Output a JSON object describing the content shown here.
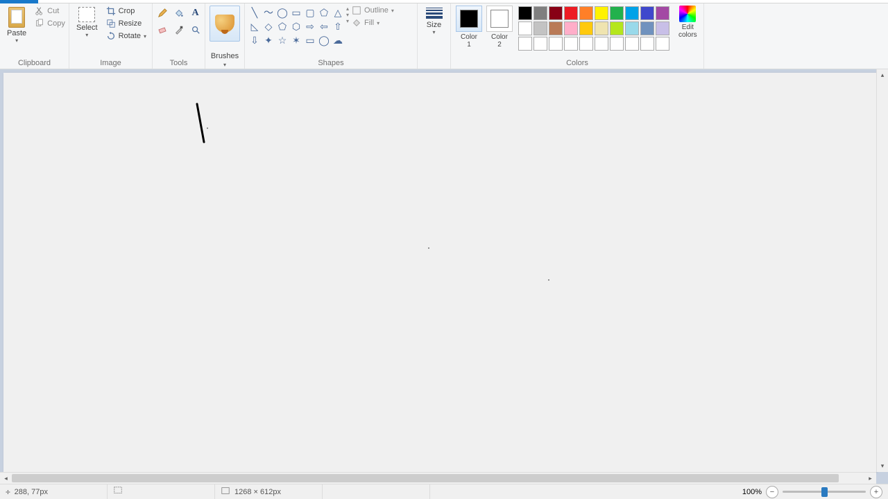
{
  "ribbon": {
    "groups": {
      "clipboard": {
        "label": "Clipboard",
        "paste": "Paste",
        "cut": "Cut",
        "copy": "Copy"
      },
      "image": {
        "label": "Image",
        "select": "Select",
        "crop": "Crop",
        "resize": "Resize",
        "rotate": "Rotate"
      },
      "tools": {
        "label": "Tools"
      },
      "brushes": {
        "label": "Brushes"
      },
      "shapes": {
        "label": "Shapes",
        "outline": "Outline",
        "fill": "Fill"
      },
      "size": {
        "label": "Size"
      },
      "colors": {
        "label": "Colors",
        "color1": "Color\n1",
        "color2": "Color\n2",
        "edit": "Edit\ncolors"
      }
    }
  },
  "palette_row1": [
    "#000000",
    "#7f7f7f",
    "#880015",
    "#ed1c24",
    "#ff7f27",
    "#fff200",
    "#22b14c",
    "#00a2e8",
    "#3f48cc",
    "#a349a4"
  ],
  "palette_row2": [
    "#ffffff",
    "#c3c3c3",
    "#b97a57",
    "#ffaec9",
    "#ffc90e",
    "#efe4b0",
    "#b5e61d",
    "#99d9ea",
    "#7092be",
    "#c8bfe7"
  ],
  "palette_row3": [
    "#ffffff",
    "#ffffff",
    "#ffffff",
    "#ffffff",
    "#ffffff",
    "#ffffff",
    "#ffffff",
    "#ffffff",
    "#ffffff",
    "#ffffff"
  ],
  "active_colors": {
    "color1": "#000000",
    "color2": "#ffffff"
  },
  "status": {
    "cursor_pos": "288, 77px",
    "canvas_size": "1268 × 612px",
    "zoom": "100%"
  }
}
